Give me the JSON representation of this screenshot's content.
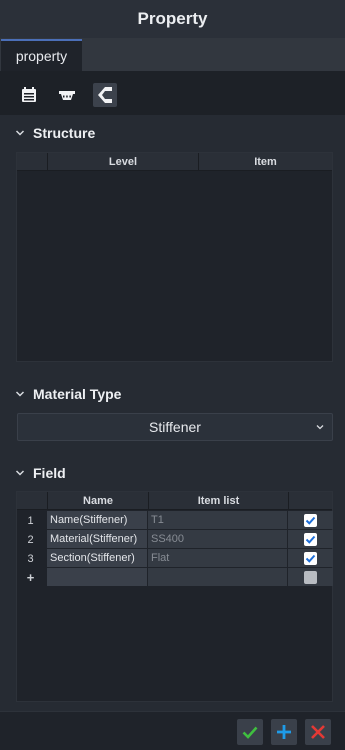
{
  "window": {
    "title": "Property"
  },
  "tabs": [
    {
      "label": "property",
      "active": true
    }
  ],
  "toolbar": {
    "buttons": [
      {
        "icon": "calendar-icon"
      },
      {
        "icon": "tray-icon"
      },
      {
        "icon": "bracket-logo-icon",
        "active": true
      }
    ]
  },
  "structure": {
    "title": "Structure",
    "columns": [
      "Level",
      "Item"
    ],
    "rows": []
  },
  "material_type": {
    "title": "Material Type",
    "selected": "Stiffener"
  },
  "field": {
    "title": "Field",
    "columns": [
      "Name",
      "Item list"
    ],
    "rows": [
      {
        "num": "1",
        "name": "Name(Stiffener)",
        "item": "T1",
        "checked": true
      },
      {
        "num": "2",
        "name": "Material(Stiffener)",
        "item": "SS400",
        "checked": true
      },
      {
        "num": "3",
        "name": "Section(Stiffener)",
        "item": "Flat",
        "checked": true
      },
      {
        "num": "+",
        "name": "",
        "item": "",
        "checked": false
      }
    ]
  },
  "footer": {
    "buttons": [
      {
        "icon": "check-icon",
        "color": "#3fbf3f"
      },
      {
        "icon": "plus-icon",
        "color": "#1e9be8"
      },
      {
        "icon": "close-icon",
        "color": "#e53935"
      }
    ]
  }
}
